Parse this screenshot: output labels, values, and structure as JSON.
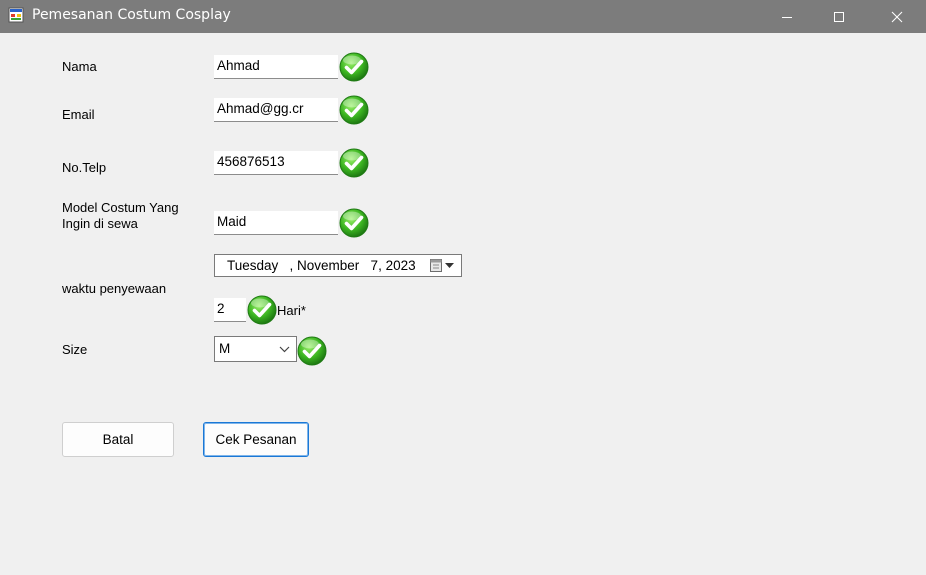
{
  "window": {
    "title": "Pemesanan Costum Cosplay",
    "controls": [
      "minimize-icon",
      "maximize-icon",
      "close-icon"
    ]
  },
  "form": {
    "nama": {
      "label": "Nama",
      "value": "Ahmad",
      "valid": true
    },
    "email": {
      "label": "Email",
      "value": "Ahmad@gg.cr",
      "valid": true
    },
    "telp": {
      "label": "No.Telp",
      "value": "456876513",
      "valid": true
    },
    "model": {
      "label_line1": "Model Costum Yang",
      "label_line2": "Ingin di sewa",
      "value": "Maid",
      "valid": true
    },
    "waktu": {
      "label": "waktu penyewaan",
      "date": "Tuesday   , November   7, 2023",
      "days": "2",
      "days_suffix": "Hari*",
      "valid": true
    },
    "size": {
      "label": "Size",
      "value": "M",
      "valid": true
    }
  },
  "buttons": {
    "batal": "Batal",
    "cek": "Cek Pesanan"
  },
  "colors": {
    "titlebar": "#7c7c7c",
    "window_bg": "#f0f0f0",
    "check_green": "#3cb521",
    "primary_border": "#1a78d6"
  }
}
